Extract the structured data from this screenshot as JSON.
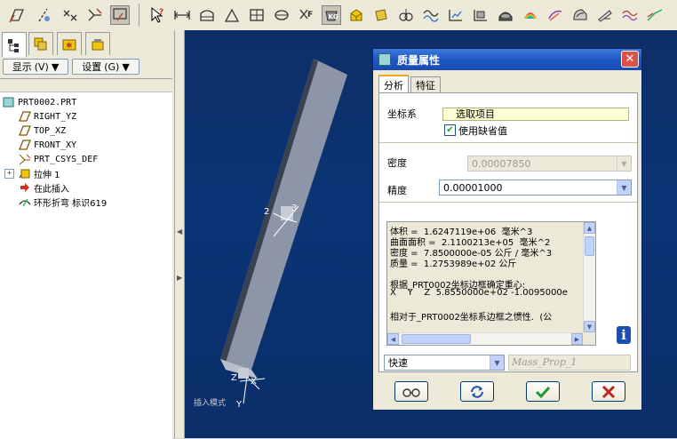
{
  "toolbar": {
    "buttons": [
      {
        "name": "sketch-datum-icon",
        "pressed": false
      },
      {
        "name": "plane-display-icon",
        "pressed": false
      },
      {
        "name": "axis-display-icon",
        "pressed": false
      },
      {
        "name": "point-display-icon",
        "pressed": false
      },
      {
        "name": "csys-display-icon",
        "pressed": true
      },
      {
        "name": "help-pointer-icon",
        "pressed": false
      },
      {
        "name": "measure-distance-icon",
        "pressed": false
      },
      {
        "name": "area-icon",
        "pressed": false
      },
      {
        "name": "angle-icon",
        "pressed": false
      },
      {
        "name": "diameter-icon",
        "pressed": false
      },
      {
        "name": "transform-icon",
        "pressed": false
      },
      {
        "name": "x-section-icon",
        "pressed": false
      },
      {
        "name": "mass-properties-icon",
        "pressed": true
      },
      {
        "name": "volume-icon",
        "pressed": false
      },
      {
        "name": "short-edge-icon",
        "pressed": false
      },
      {
        "name": "pair-clearance-icon",
        "pressed": false
      },
      {
        "name": "curve-analysis-icon",
        "pressed": false
      },
      {
        "name": "surface-analysis-icon",
        "pressed": false
      },
      {
        "name": "curvature-icon",
        "pressed": false
      },
      {
        "name": "shade-icon",
        "pressed": false
      },
      {
        "name": "draft-check-icon",
        "pressed": false
      },
      {
        "name": "slope-icon",
        "pressed": false
      },
      {
        "name": "reflection-icon",
        "pressed": false
      },
      {
        "name": "deviation-icon",
        "pressed": false
      },
      {
        "name": "dihedral-icon",
        "pressed": false
      }
    ]
  },
  "left_panel": {
    "tabs": [
      "model-tree-tab",
      "layer-tab",
      "favorites-tab",
      "tools-tab"
    ],
    "show_button": "显示 ⓥ ▼",
    "show_label": "显示",
    "show_shortcut": "(V)",
    "settings_label": "设置",
    "settings_shortcut": "(G)",
    "tree": [
      {
        "label": "PRT0002.PRT",
        "icon": "part-icon",
        "indent": 0,
        "expander": false
      },
      {
        "label": "RIGHT_YZ",
        "icon": "datum-plane-icon",
        "indent": 1,
        "expander": false
      },
      {
        "label": "TOP_XZ",
        "icon": "datum-plane-icon",
        "indent": 1,
        "expander": false
      },
      {
        "label": "FRONT_XY",
        "icon": "datum-plane-icon",
        "indent": 1,
        "expander": false
      },
      {
        "label": "PRT_CSYS_DEF",
        "icon": "csys-icon",
        "indent": 1,
        "expander": false
      },
      {
        "label": "拉伸 1",
        "icon": "extrude-icon",
        "indent": 1,
        "expander": true
      },
      {
        "label": "在此插入",
        "icon": "insert-here-icon",
        "indent": 1,
        "expander": false
      },
      {
        "label": "环形折弯 标识619",
        "icon": "toroidal-bend-icon",
        "indent": 1,
        "expander": false
      }
    ]
  },
  "viewport": {
    "label": "插入模式",
    "csys_axis_labels": [
      "2",
      "3",
      "Z",
      "X",
      "Y"
    ]
  },
  "dialog": {
    "title": "质量属性",
    "tabs": [
      "分析",
      "特征"
    ],
    "active_tab": "分析",
    "csys_label": "坐标系",
    "csys_select_text": "选取项目",
    "use_default_label": "使用缺省值",
    "use_default_checked": true,
    "density_label": "密度",
    "density_value": "0.00007850",
    "accuracy_label": "精度",
    "accuracy_value": "0.00001000",
    "results_lines": [
      "体积 =  1.6247119e+06  毫米^3",
      "曲面面积 =  2.1100213e+05  毫米^2",
      "密度 =  7.8500000e-05 公斤 / 毫米^3",
      "质量 =  1.2753989e+02 公斤",
      "",
      "根据_PRT0002坐标边框确定重心:",
      "X    Y    Z  5.8550000e+02 -1.0095000e",
      "",
      "相对于_PRT0002坐标系边框之惯性.  (公"
    ],
    "mode_value": "快速",
    "name_value": "Mass_Prop_1",
    "buttons": [
      "preview-glasses",
      "repeat",
      "ok",
      "cancel"
    ]
  },
  "colors": {
    "viewport_bg": "#0b3475",
    "title_bar": "#1d57c5",
    "model_shaded": "#8d96a8"
  }
}
